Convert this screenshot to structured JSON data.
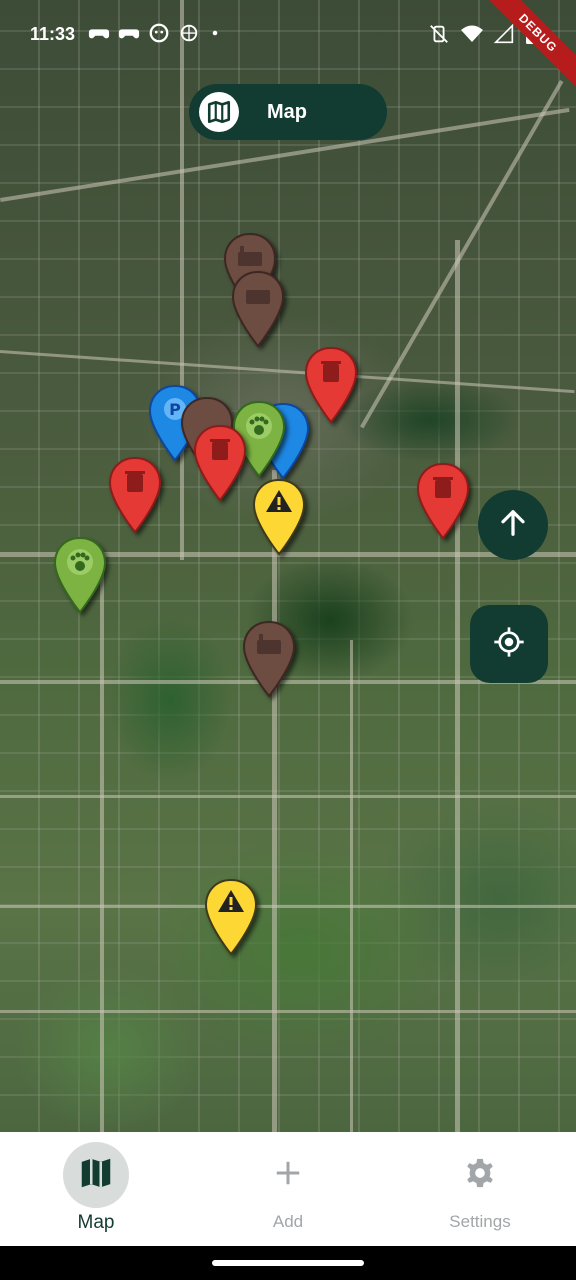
{
  "status_bar": {
    "time": "11:33",
    "debug_label": "DEBUG",
    "left_icons": [
      "gamepad-icon",
      "gamepad-icon",
      "face-icon",
      "crosshair-icon",
      "dot-icon"
    ],
    "right_icons": [
      "vibrate-off-icon",
      "wifi-icon",
      "signal-icon",
      "battery-icon"
    ]
  },
  "header": {
    "title": "Map",
    "icon": "map-icon"
  },
  "map": {
    "type": "satellite",
    "markers": [
      {
        "category": "brown",
        "icon": "factory-icon",
        "color": "#6d4c41"
      },
      {
        "category": "brown",
        "icon": "factory-icon",
        "color": "#6d4c41"
      },
      {
        "category": "red",
        "icon": "trash-icon",
        "color": "#e53935"
      },
      {
        "category": "blue",
        "icon": "parking-icon",
        "color": "#1e88e5"
      },
      {
        "category": "brown",
        "icon": "factory-icon",
        "color": "#6d4c41"
      },
      {
        "category": "blue",
        "icon": "parking-icon",
        "color": "#1e88e5"
      },
      {
        "category": "green",
        "icon": "paw-icon",
        "color": "#7cb342"
      },
      {
        "category": "red",
        "icon": "trash-icon",
        "color": "#e53935"
      },
      {
        "category": "red",
        "icon": "trash-icon",
        "color": "#e53935"
      },
      {
        "category": "yellow",
        "icon": "warning-icon",
        "color": "#fdd835"
      },
      {
        "category": "red",
        "icon": "trash-icon",
        "color": "#e53935"
      },
      {
        "category": "green",
        "icon": "paw-icon",
        "color": "#7cb342"
      },
      {
        "category": "brown",
        "icon": "factory-icon",
        "color": "#6d4c41"
      },
      {
        "category": "yellow",
        "icon": "warning-icon",
        "color": "#fdd835"
      }
    ]
  },
  "fabs": {
    "up": "arrow-up-icon",
    "locate": "my-location-icon"
  },
  "bottom_nav": {
    "items": [
      {
        "label": "Map",
        "icon": "map-icon",
        "active": true
      },
      {
        "label": "Add",
        "icon": "plus-icon",
        "active": false
      },
      {
        "label": "Settings",
        "icon": "gear-icon",
        "active": false
      }
    ]
  },
  "colors": {
    "primary": "#123c32",
    "nav_bg": "#ffffff",
    "active_pill": "#d8dcdb",
    "inactive": "#a3a6a8"
  }
}
